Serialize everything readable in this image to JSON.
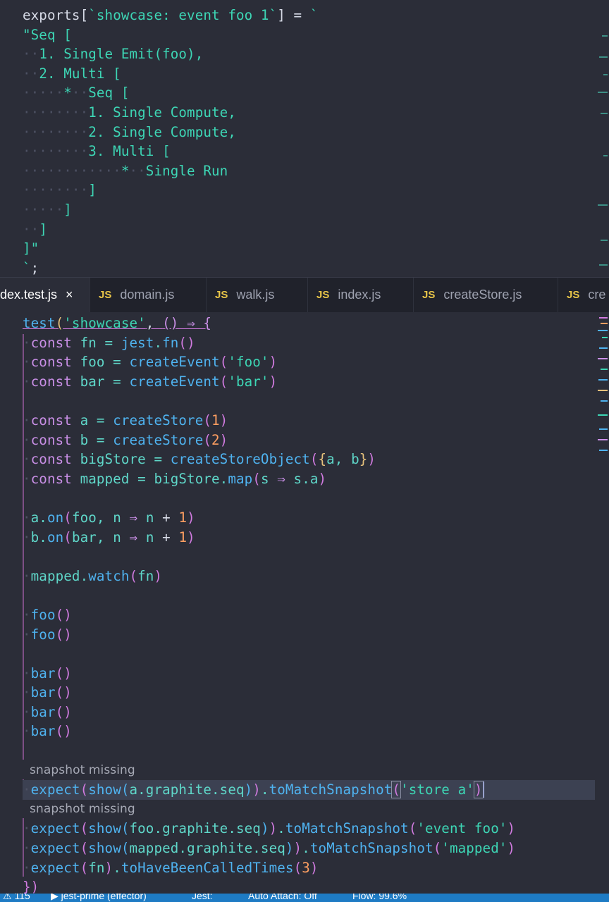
{
  "top_editor": {
    "lines": [
      "exports[`showcase: event foo 1`] = `",
      "\"Seq [",
      "  1. Single Emit(foo),",
      "  2. Multi [",
      "     *  Seq [",
      "        1. Single Compute,",
      "        2. Single Compute,",
      "        3. Multi [",
      "            *  Single Run",
      "        ]",
      "     ]",
      "  ]",
      "]\"",
      "`;"
    ]
  },
  "tabs": [
    {
      "label": "dex.test.js",
      "active": true,
      "close": "×"
    },
    {
      "label": "domain.js",
      "icon": "JS"
    },
    {
      "label": "walk.js",
      "icon": "JS"
    },
    {
      "label": "index.js",
      "icon": "JS"
    },
    {
      "label": "createStore.js",
      "icon": "JS"
    },
    {
      "label": "cre",
      "icon": "JS"
    }
  ],
  "code": {
    "l1_test": "test",
    "l1_str": "'showcase'",
    "l1_arrow": "() ⇒ {",
    "codelens_1": "snapshot missing",
    "codelens_2": "snapshot missing"
  },
  "status_bar": {
    "warnings": "⚠ 115",
    "run": "▶ jest-prime (effector)",
    "jest": "Jest:",
    "auto_attach": "Auto Attach: Off",
    "flow": "Flow: 99.6%"
  },
  "colors": {
    "background": "#2b2d38",
    "tabbar": "#20222b",
    "statusbar": "#1e7bc4",
    "accent_teal": "#5fd7c9",
    "keyword_purple": "#c98fe6"
  }
}
